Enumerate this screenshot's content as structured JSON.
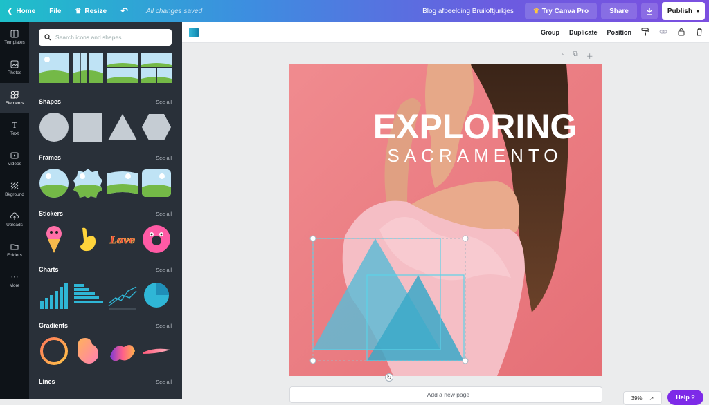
{
  "topbar": {
    "home": "Home",
    "file": "File",
    "resize": "Resize",
    "saved_status": "All changes saved",
    "doc_title": "Blog afbeelding Bruiloftjurkjes",
    "try_pro": "Try Canva Pro",
    "share": "Share",
    "publish": "Publish"
  },
  "rail": [
    {
      "label": "Templates",
      "icon": "templates-icon"
    },
    {
      "label": "Photos",
      "icon": "photos-icon"
    },
    {
      "label": "Elements",
      "icon": "elements-icon"
    },
    {
      "label": "Text",
      "icon": "text-icon"
    },
    {
      "label": "Videos",
      "icon": "videos-icon"
    },
    {
      "label": "Bkground",
      "icon": "background-icon"
    },
    {
      "label": "Uploads",
      "icon": "uploads-icon"
    },
    {
      "label": "Folders",
      "icon": "folders-icon"
    },
    {
      "label": "More",
      "icon": "more-icon"
    }
  ],
  "panel": {
    "search_placeholder": "Search icons and shapes",
    "see_all": "See all",
    "sections": {
      "shapes": "Shapes",
      "frames": "Frames",
      "stickers": "Stickers",
      "charts": "Charts",
      "gradients": "Gradients",
      "lines": "Lines"
    }
  },
  "context_bar": {
    "group": "Group",
    "duplicate": "Duplicate",
    "position": "Position",
    "accent_color": "#1d9bc0"
  },
  "design": {
    "headline": "EXPLORING",
    "subhead": "SACRAMENTO",
    "background_color": "#e8777d",
    "triangle_color": "#5bbcd6"
  },
  "canvas": {
    "add_page": "+ Add a new page",
    "zoom": "39%",
    "help": "Help ?"
  }
}
